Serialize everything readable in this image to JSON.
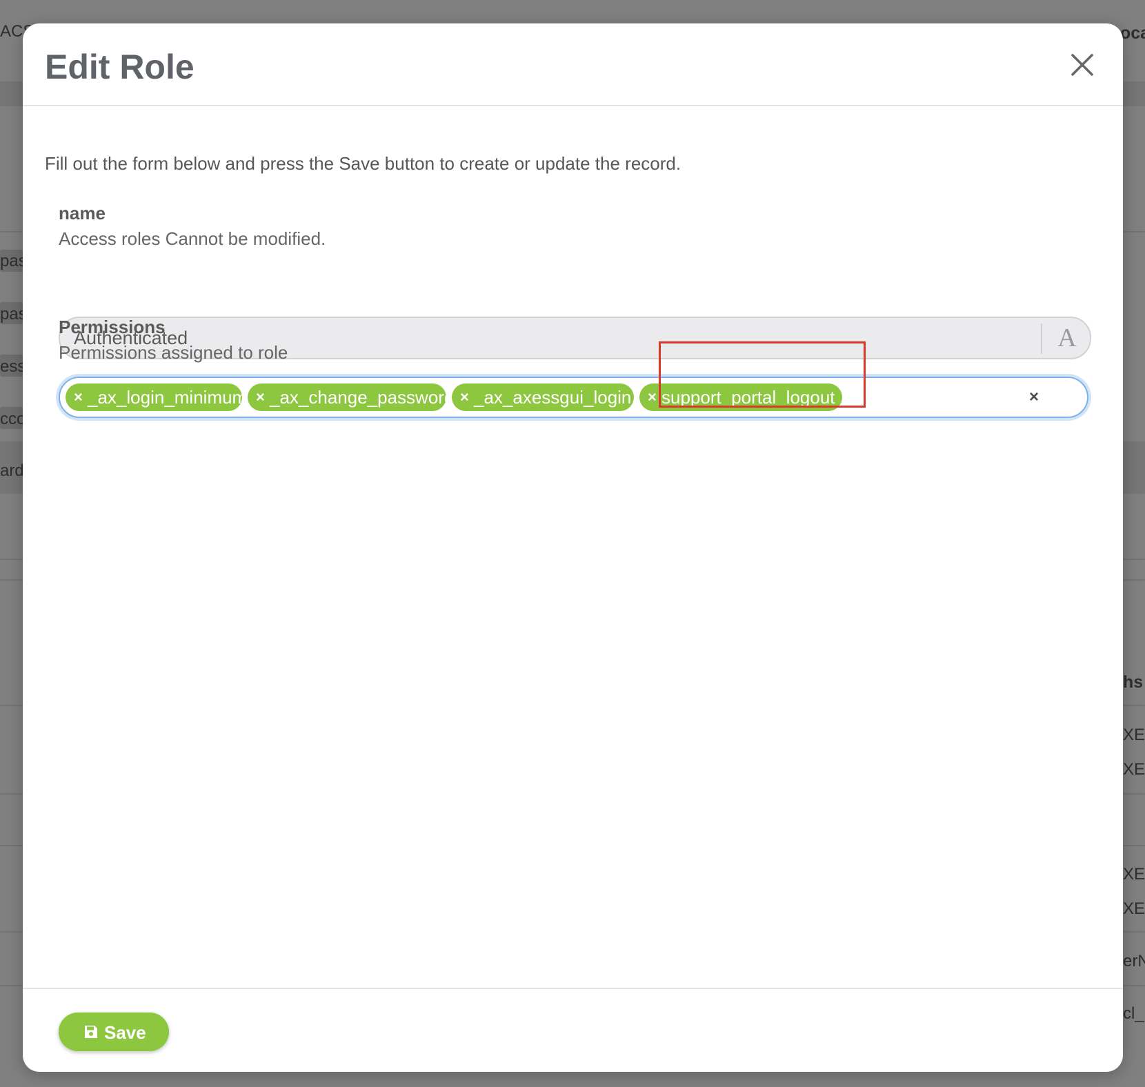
{
  "background": {
    "fragments": [
      "ACS",
      "oca",
      "pas",
      "pas",
      "ess",
      "cco",
      "ard",
      "hs",
      "XE",
      "XE",
      "XE",
      "XE",
      "erN",
      "cl_"
    ]
  },
  "modal": {
    "title": "Edit Role",
    "intro": "Fill out the form below and press the Save button to create or update the record.",
    "name_field": {
      "label": "name",
      "help": "Access roles Cannot be modified.",
      "value": "Authenticated",
      "type_icon_glyph": "A"
    },
    "permissions_field": {
      "label": "Permissions",
      "help": "Permissions assigned to role",
      "tags": [
        {
          "remove": "×",
          "label": "_ax_login_minimum"
        },
        {
          "remove": "×",
          "label": "_ax_change_password"
        },
        {
          "remove": "×",
          "label": "_ax_axessgui_login"
        },
        {
          "remove": "×",
          "label": "support_portal_logout"
        }
      ],
      "clear_glyph": "×",
      "highlighted_tag": "support_portal_logout"
    },
    "footer": {
      "save_label": "Save"
    }
  },
  "colors": {
    "tag_green": "#8dc63f",
    "focus_blue": "#7fb2ea",
    "highlight_red": "#d9392b",
    "title_gray": "#5f6368"
  }
}
